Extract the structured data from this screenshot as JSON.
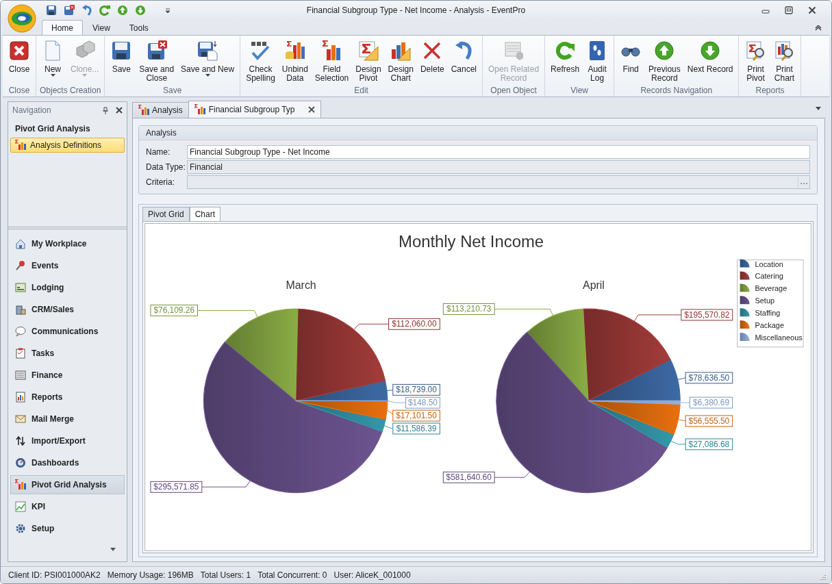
{
  "window": {
    "title": "Financial Subgroup Type - Net Income - Analysis - EventPro"
  },
  "ribbon": {
    "tabs": [
      {
        "label": "Home",
        "selected": true
      },
      {
        "label": "View",
        "selected": false
      },
      {
        "label": "Tools",
        "selected": false
      }
    ],
    "groups": [
      {
        "label": "Close",
        "buttons": [
          {
            "label": "Close",
            "disabled": false,
            "dropdown": false
          }
        ]
      },
      {
        "label": "Objects Creation",
        "buttons": [
          {
            "label": "New",
            "disabled": false,
            "dropdown": true
          },
          {
            "label": "Clone...",
            "disabled": true,
            "dropdown": true
          }
        ]
      },
      {
        "label": "Save",
        "buttons": [
          {
            "label": "Save",
            "disabled": false,
            "dropdown": false
          },
          {
            "label": "Save and\nClose",
            "disabled": false,
            "dropdown": false
          },
          {
            "label": "Save and New",
            "disabled": false,
            "dropdown": true
          }
        ]
      },
      {
        "label": "Edit",
        "buttons": [
          {
            "label": "Check\nSpelling",
            "disabled": false,
            "dropdown": false
          },
          {
            "label": "Unbind\nData",
            "disabled": false,
            "dropdown": false
          },
          {
            "label": "Field\nSelection",
            "disabled": false,
            "dropdown": false
          },
          {
            "label": "Design\nPivot",
            "disabled": false,
            "dropdown": false
          },
          {
            "label": "Design\nChart",
            "disabled": false,
            "dropdown": false
          },
          {
            "label": "Delete",
            "disabled": false,
            "dropdown": false
          },
          {
            "label": "Cancel",
            "disabled": false,
            "dropdown": false
          }
        ]
      },
      {
        "label": "Open Object",
        "buttons": [
          {
            "label": "Open Related\nRecord",
            "disabled": true,
            "dropdown": false
          }
        ]
      },
      {
        "label": "View",
        "buttons": [
          {
            "label": "Refresh",
            "disabled": false,
            "dropdown": false
          },
          {
            "label": "Audit\nLog",
            "disabled": false,
            "dropdown": false
          }
        ]
      },
      {
        "label": "Records Navigation",
        "buttons": [
          {
            "label": "Find",
            "disabled": false,
            "dropdown": false
          },
          {
            "label": "Previous\nRecord",
            "disabled": false,
            "dropdown": false
          },
          {
            "label": "Next Record",
            "disabled": false,
            "dropdown": false
          }
        ]
      },
      {
        "label": "Reports",
        "buttons": [
          {
            "label": "Print\nPivot",
            "disabled": false,
            "dropdown": false
          },
          {
            "label": "Print\nChart",
            "disabled": false,
            "dropdown": false
          }
        ]
      }
    ]
  },
  "navigation": {
    "title": "Navigation",
    "section_title": "Pivot Grid Analysis",
    "items": [
      {
        "label": "Analysis Definitions",
        "selected": true
      }
    ],
    "modules": [
      {
        "label": "My Workplace",
        "selected": false
      },
      {
        "label": "Events",
        "selected": false
      },
      {
        "label": "Lodging",
        "selected": false
      },
      {
        "label": "CRM/Sales",
        "selected": false
      },
      {
        "label": "Communications",
        "selected": false
      },
      {
        "label": "Tasks",
        "selected": false
      },
      {
        "label": "Finance",
        "selected": false
      },
      {
        "label": "Reports",
        "selected": false
      },
      {
        "label": "Mail Merge",
        "selected": false
      },
      {
        "label": "Import/Export",
        "selected": false
      },
      {
        "label": "Dashboards",
        "selected": false
      },
      {
        "label": "Pivot Grid Analysis",
        "selected": true
      },
      {
        "label": "KPI",
        "selected": false
      },
      {
        "label": "Setup",
        "selected": false
      }
    ]
  },
  "document_tabs": [
    {
      "label": "Analysis",
      "selected": false
    },
    {
      "label": "Financial Subgroup Typ",
      "selected": true
    }
  ],
  "analysis": {
    "title": "Analysis",
    "fields": [
      {
        "label": "Name:",
        "value": "Financial Subgroup Type - Net Income",
        "kind": "text",
        "readonly": false
      },
      {
        "label": "Data Type:",
        "value": "Financial",
        "kind": "text",
        "readonly": true
      },
      {
        "label": "Criteria:",
        "kind": "lookup",
        "readonly": true
      }
    ]
  },
  "view_tabs": [
    {
      "label": "Pivot Grid",
      "selected": false
    },
    {
      "label": "Chart",
      "selected": true
    }
  ],
  "chart_data": {
    "type": "pie",
    "title": "Monthly Net Income",
    "categories": [
      "Location",
      "Catering",
      "Beverage",
      "Setup",
      "Staffing",
      "Package",
      "Miscellaneous"
    ],
    "colors": [
      "#3d6aa5",
      "#a33c3a",
      "#8aac45",
      "#6c5490",
      "#3597ab",
      "#e8700e",
      "#93b1de"
    ],
    "series": [
      {
        "name": "March",
        "values": [
          18739.0,
          112060.0,
          76109.26,
          295571.85,
          11586.39,
          17101.5,
          148.5
        ],
        "value_labels": [
          "$18,739.00",
          "$112,060.00",
          "$76,109.26",
          "$295,571.85",
          "$11,586.39",
          "$17,101.50",
          "$148.50"
        ]
      },
      {
        "name": "April",
        "values": [
          78636.5,
          195570.82,
          113210.73,
          581640.6,
          27086.68,
          56555.5,
          6380.69
        ],
        "value_labels": [
          "$78,636.50",
          "$195,570.82",
          "$113,210.73",
          "$581,640.60",
          "$27,086.68",
          "$56,555.50",
          "$6,380.69"
        ]
      }
    ],
    "data_labels": true,
    "legend": true
  },
  "status_bar": [
    "Client ID: PSI001000AK2",
    "Memory Usage: 196MB",
    "Total Users: 1",
    "Total Concurrent: 0",
    "User: AliceK_001000"
  ]
}
